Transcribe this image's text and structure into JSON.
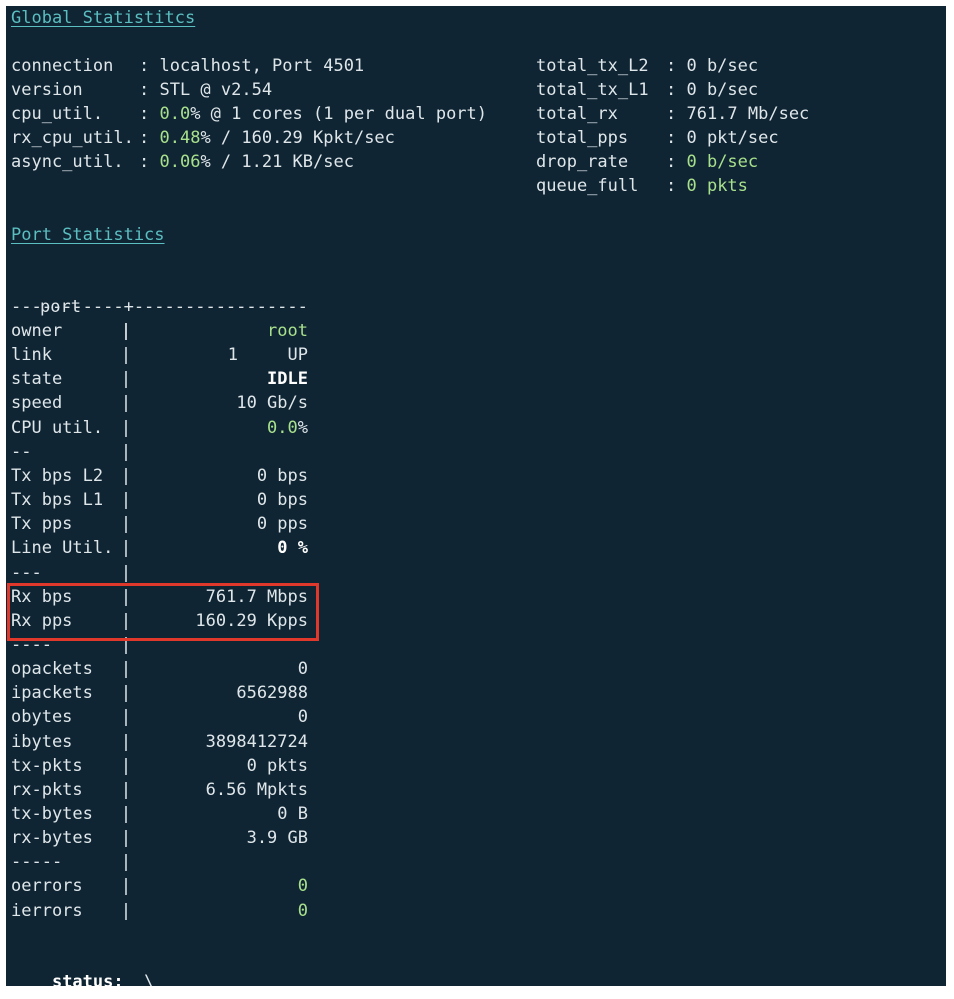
{
  "global": {
    "heading": "Global Statistitcs",
    "left": [
      {
        "key": "connection",
        "val": ": localhost, Port 4501",
        "green": ""
      },
      {
        "key": "version",
        "val": ": STL @ v2.54",
        "green": ""
      },
      {
        "key": "cpu_util.",
        "pre": ": ",
        "green": "0.0",
        "post": "% @ 1 cores (1 per dual port)"
      },
      {
        "key": "rx_cpu_util.",
        "pre": ": ",
        "green": "0.48",
        "post": "% / 160.29 Kpkt/sec"
      },
      {
        "key": "async_util.",
        "pre": ": ",
        "green": "0.06",
        "post": "% / 1.21 KB/sec"
      }
    ],
    "right": [
      {
        "key": "total_tx_L2",
        "pre": ": 0 b/sec",
        "green": ""
      },
      {
        "key": "total_tx_L1",
        "pre": ": 0 b/sec",
        "green": ""
      },
      {
        "key": "total_rx",
        "pre": ": 761.7 Mb/sec",
        "green": ""
      },
      {
        "key": "total_pps",
        "pre": ": 0 pkt/sec",
        "green": ""
      },
      {
        "key": "drop_rate",
        "pre": ": ",
        "green": "0 b/sec"
      },
      {
        "key": "queue_full",
        "pre": ": ",
        "green": "0 pkts"
      }
    ]
  },
  "port_stats": {
    "heading": "Port Statistics",
    "header_label": "port",
    "header_value": "1",
    "divider": "-----------+-----------------",
    "rows": [
      {
        "label": "owner",
        "value": "root",
        "style": "green"
      },
      {
        "label": "link",
        "value": "UP",
        "style": ""
      },
      {
        "label": "state",
        "value": "IDLE",
        "style": "bold"
      },
      {
        "label": "speed",
        "value": "10 Gb/s",
        "style": ""
      },
      {
        "label": "CPU util.",
        "value": "0.0",
        "suffix": "%",
        "style": "green"
      },
      {
        "label": "--",
        "value": "",
        "style": ""
      },
      {
        "label": "Tx bps L2",
        "value": "0 bps",
        "style": ""
      },
      {
        "label": "Tx bps L1",
        "value": "0 bps",
        "style": ""
      },
      {
        "label": "Tx pps",
        "value": "0 pps",
        "style": ""
      },
      {
        "label": "Line Util.",
        "value": "0 %",
        "style": "bold"
      },
      {
        "label": "---",
        "value": "",
        "style": ""
      },
      {
        "label": "Rx bps",
        "value": "761.7 Mbps",
        "style": ""
      },
      {
        "label": "Rx pps",
        "value": "160.29 Kpps",
        "style": ""
      },
      {
        "label": "----",
        "value": "",
        "style": ""
      },
      {
        "label": "opackets",
        "value": "0",
        "style": ""
      },
      {
        "label": "ipackets",
        "value": "6562988",
        "style": ""
      },
      {
        "label": "obytes",
        "value": "0",
        "style": ""
      },
      {
        "label": "ibytes",
        "value": "3898412724",
        "style": ""
      },
      {
        "label": "tx-pkts",
        "value": "0 pkts",
        "style": ""
      },
      {
        "label": "rx-pkts",
        "value": "6.56 Mpkts",
        "style": ""
      },
      {
        "label": "tx-bytes",
        "value": "0 B",
        "style": ""
      },
      {
        "label": "rx-bytes",
        "value": "3.9 GB",
        "style": ""
      },
      {
        "label": "-----",
        "value": "",
        "style": ""
      },
      {
        "label": "oerrors",
        "value": "0",
        "style": "green"
      },
      {
        "label": "ierrors",
        "value": "0",
        "style": "green"
      }
    ]
  },
  "status": {
    "label": "status:",
    "spinner": "\\"
  },
  "colors": {
    "background": "#0f2533",
    "text": "#dfe6ea",
    "heading": "#5bbec0",
    "green": "#a8e08c",
    "highlight_border": "#e0392b"
  }
}
